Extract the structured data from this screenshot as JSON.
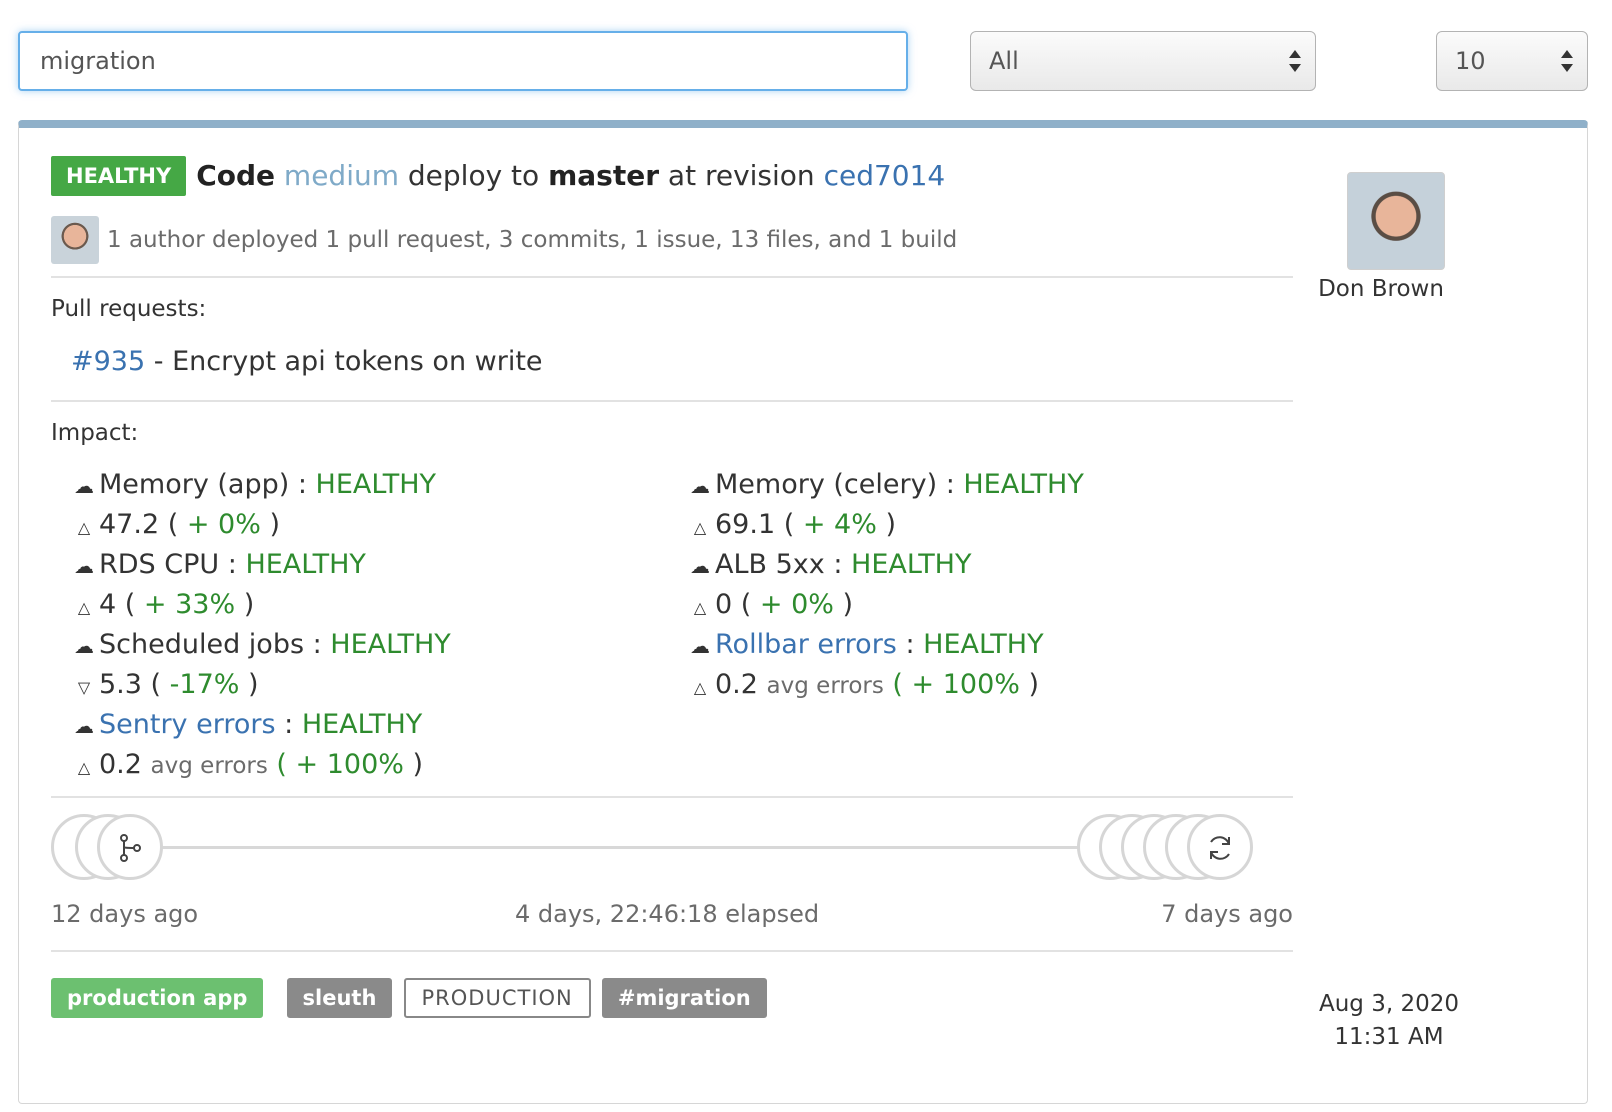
{
  "search": {
    "value": "migration"
  },
  "filters": {
    "status_selected": "All",
    "per_page_selected": "10"
  },
  "deploy": {
    "status_badge": "HEALTHY",
    "title_prefix": "Code",
    "project": "medium",
    "title_middle": "deploy to",
    "branch": "master",
    "title_revision_label": "at revision",
    "revision": "ced7014",
    "summary": "1 author deployed 1 pull request, 3 commits, 1 issue, 13 files, and 1 build",
    "author_name": "Don Brown"
  },
  "pull_requests": {
    "label": "Pull requests:",
    "items": [
      {
        "number": "#935",
        "separator": "-",
        "title": "Encrypt api tokens on write"
      }
    ]
  },
  "impact": {
    "label": "Impact:",
    "left": [
      {
        "name": "Memory (app)",
        "status": "HEALTHY",
        "trend": "up",
        "value": "47.2",
        "unit": "",
        "change": "+ 0%"
      },
      {
        "name": "RDS CPU",
        "status": "HEALTHY",
        "trend": "up",
        "value": "4",
        "unit": "",
        "change": "+ 33%"
      },
      {
        "name": "Scheduled jobs",
        "status": "HEALTHY",
        "trend": "down",
        "value": "5.3",
        "unit": "",
        "change": "-17%"
      },
      {
        "name": "Sentry errors",
        "status": "HEALTHY",
        "trend": "up",
        "value": "0.2",
        "unit": "avg errors",
        "change": "+ 100%",
        "is_link": true
      }
    ],
    "right": [
      {
        "name": "Memory (celery)",
        "status": "HEALTHY",
        "trend": "up",
        "value": "69.1",
        "unit": "",
        "change": "+ 4%"
      },
      {
        "name": "ALB 5xx",
        "status": "HEALTHY",
        "trend": "up",
        "value": "0",
        "unit": "",
        "change": "+ 0%"
      },
      {
        "name": "Rollbar errors",
        "status": "HEALTHY",
        "trend": "up",
        "value": "0.2",
        "unit": "avg errors",
        "change": "+ 100%",
        "is_link": true
      }
    ]
  },
  "timeline": {
    "start_label": "12 days ago",
    "elapsed_label": "4 days, 22:46:18 elapsed",
    "end_label": "7 days ago",
    "icons": {
      "start": "branch-icon",
      "end": "refresh-icon"
    }
  },
  "tags": {
    "environment_app": "production app",
    "project_tag": "sleuth",
    "environment": "PRODUCTION",
    "hashtag": "#migration"
  },
  "date": {
    "line1": "Aug 3, 2020",
    "line2": "11:31 AM"
  },
  "colors": {
    "healthy": "#45a845",
    "green_text": "#2e8b2e",
    "link": "#3a72b0",
    "card_top": "#8fb0c9"
  }
}
